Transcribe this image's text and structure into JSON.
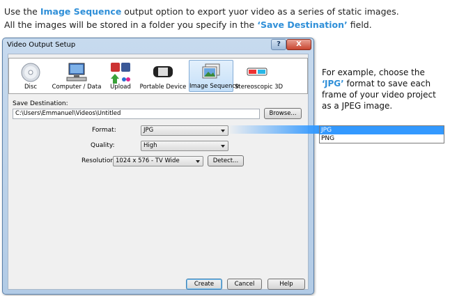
{
  "intro": {
    "line1_pre": "Use the ",
    "line1_hl": "Image Sequence",
    "line1_post": " output option to export yuor video as a series of static images.",
    "line2_pre": "All the images will be stored in a folder you specify in the ",
    "line2_hl": "‘Save Destination’",
    "line2_post": " field."
  },
  "dialog": {
    "title": "Video Output Setup",
    "help_glyph": "?",
    "close_glyph": "X",
    "categories": [
      {
        "label": "Disc",
        "icon": "disc-icon"
      },
      {
        "label": "Computer / Data",
        "icon": "computer-icon"
      },
      {
        "label": "Upload",
        "icon": "upload-icon"
      },
      {
        "label": "Portable Device",
        "icon": "portable-device-icon"
      },
      {
        "label": "Image Sequence",
        "icon": "image-sequence-icon"
      },
      {
        "label": "Stereoscopic 3D",
        "icon": "3d-glasses-icon"
      }
    ],
    "selected_category": "Image Sequence",
    "save_destination_label": "Save Destination:",
    "save_destination_value": "C:\\Users\\Emmanuel\\Videos\\Untitled",
    "browse_label": "Browse...",
    "format_label": "Format:",
    "format_value": "JPG",
    "quality_label": "Quality:",
    "quality_value": "High",
    "resolution_label": "Resolution:",
    "resolution_value": "1024 x 576 - TV Wide",
    "detect_label": "Detect...",
    "create_label": "Create",
    "cancel_label": "Cancel",
    "help_label": "Help"
  },
  "callout": {
    "pre": "For example, choose the ",
    "hl": "‘JPG’",
    "post": " format to save each frame of your video project as a JPEG image."
  },
  "format_dropdown": {
    "options": [
      "JPG",
      "PNG"
    ],
    "selected": "JPG"
  },
  "colors": {
    "accent": "#2f8fd8",
    "selection": "#3399ff"
  }
}
